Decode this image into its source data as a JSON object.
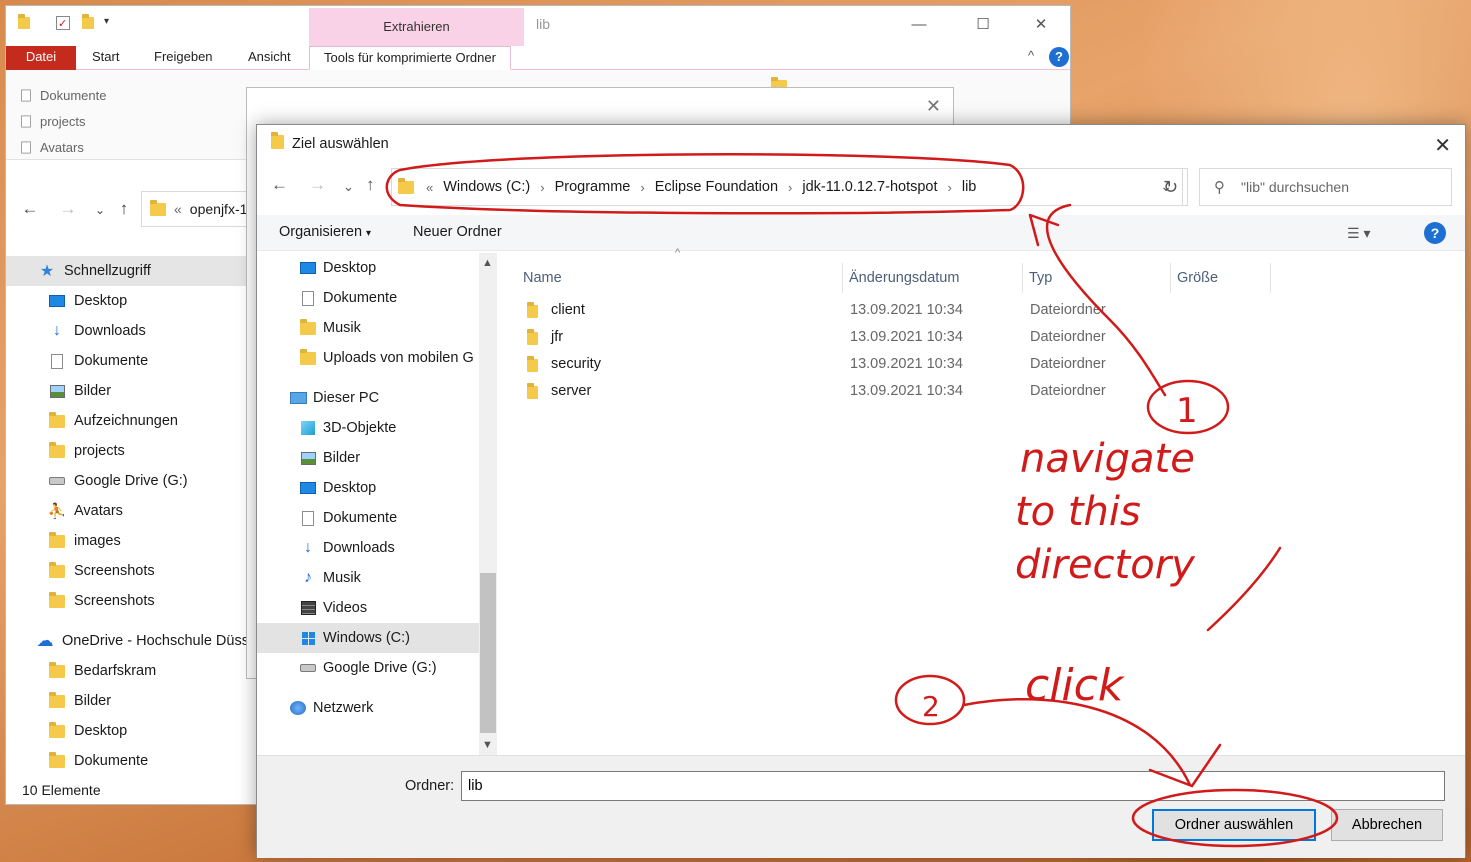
{
  "explorer": {
    "window_title": "lib",
    "context_tab": "Extrahieren",
    "ribbon_tabs": [
      "Datei",
      "Start",
      "Freigeben",
      "Ansicht",
      "Tools für komprimierte Ordner"
    ],
    "ribbon_items": [
      "Dokumente",
      "projects",
      "Avatars"
    ],
    "address_text": "openjfx-1",
    "nav_items": [
      {
        "label": "Schnellzugriff",
        "icon": "star-icon"
      },
      {
        "label": "Desktop",
        "icon": "desktop-icon"
      },
      {
        "label": "Downloads",
        "icon": "download-icon"
      },
      {
        "label": "Dokumente",
        "icon": "document-icon"
      },
      {
        "label": "Bilder",
        "icon": "pictures-icon"
      },
      {
        "label": "Aufzeichnungen",
        "icon": "folder-icon"
      },
      {
        "label": "projects",
        "icon": "folder-icon"
      },
      {
        "label": "Google Drive (G:)",
        "icon": "drive-icon"
      },
      {
        "label": "Avatars",
        "icon": "person-icon"
      },
      {
        "label": "images",
        "icon": "folder-icon"
      },
      {
        "label": "Screenshots",
        "icon": "folder-icon"
      },
      {
        "label": "Screenshots",
        "icon": "folder-icon"
      },
      {
        "label": "OneDrive - Hochschule Düss",
        "icon": "onedrive-icon"
      },
      {
        "label": "Bedarfskram",
        "icon": "folder-icon"
      },
      {
        "label": "Bilder",
        "icon": "folder-icon"
      },
      {
        "label": "Desktop",
        "icon": "folder-icon"
      },
      {
        "label": "Dokumente",
        "icon": "folder-icon"
      }
    ],
    "status": "10 Elemente"
  },
  "dialog": {
    "title": "Ziel auswählen",
    "breadcrumb": [
      "Windows (C:)",
      "Programme",
      "Eclipse Foundation",
      "jdk-11.0.12.7-hotspot",
      "lib"
    ],
    "breadcrumb_overflow": "«",
    "search_placeholder": "\"lib\" durchsuchen",
    "toolbar": {
      "organize": "Organisieren",
      "new_folder": "Neuer Ordner"
    },
    "nav_items": [
      {
        "label": "Desktop",
        "icon": "desktop-icon"
      },
      {
        "label": "Dokumente",
        "icon": "document-icon"
      },
      {
        "label": "Musik",
        "icon": "folder-icon"
      },
      {
        "label": "Uploads von mobilen G",
        "icon": "folder-icon"
      },
      {
        "label": "Dieser PC",
        "icon": "pc-icon"
      },
      {
        "label": "3D-Objekte",
        "icon": "cube-icon"
      },
      {
        "label": "Bilder",
        "icon": "pictures-icon"
      },
      {
        "label": "Desktop",
        "icon": "desktop-icon"
      },
      {
        "label": "Dokumente",
        "icon": "document-icon"
      },
      {
        "label": "Downloads",
        "icon": "download-icon"
      },
      {
        "label": "Musik",
        "icon": "music-icon"
      },
      {
        "label": "Videos",
        "icon": "video-icon"
      },
      {
        "label": "Windows (C:)",
        "icon": "windows-drive-icon"
      },
      {
        "label": "Google Drive (G:)",
        "icon": "drive-icon"
      },
      {
        "label": "Netzwerk",
        "icon": "network-icon"
      }
    ],
    "columns": [
      "Name",
      "Änderungsdatum",
      "Typ",
      "Größe"
    ],
    "files": [
      {
        "name": "client",
        "date": "13.09.2021 10:34",
        "type": "Dateiordner"
      },
      {
        "name": "jfr",
        "date": "13.09.2021 10:34",
        "type": "Dateiordner"
      },
      {
        "name": "security",
        "date": "13.09.2021 10:34",
        "type": "Dateiordner"
      },
      {
        "name": "server",
        "date": "13.09.2021 10:34",
        "type": "Dateiordner"
      }
    ],
    "folder_label": "Ordner:",
    "folder_value": "lib",
    "select_button": "Ordner auswählen",
    "cancel_button": "Abbrechen"
  },
  "annotations": {
    "step1_number": "1",
    "step1_text": [
      "navigate",
      "to  this",
      "directory"
    ],
    "step2_number": "2",
    "step2_text": "click",
    "color": "#d11a1a"
  }
}
